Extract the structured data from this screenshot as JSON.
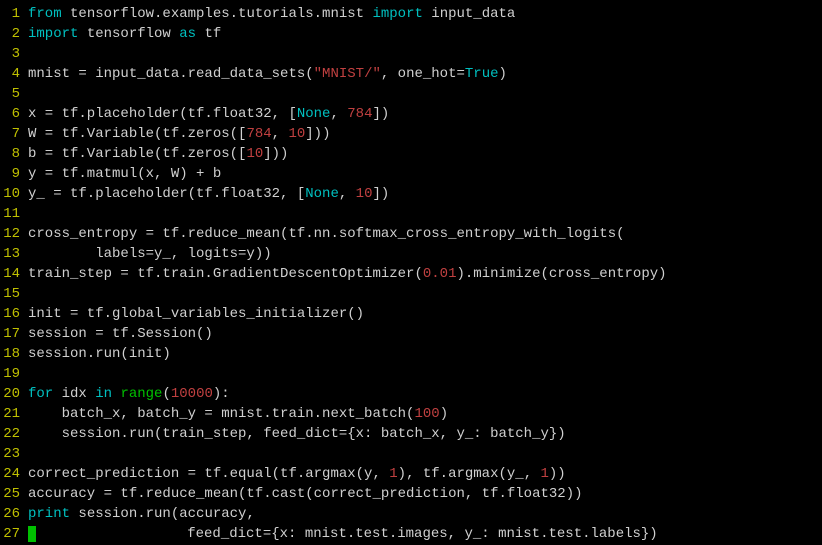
{
  "lines": [
    {
      "n": "1",
      "tokens": [
        [
          "kw",
          "from"
        ],
        [
          "ident",
          " tensorflow.examples.tutorials.mnist "
        ],
        [
          "kw",
          "import"
        ],
        [
          "ident",
          " input_data"
        ]
      ]
    },
    {
      "n": "2",
      "tokens": [
        [
          "kw",
          "import"
        ],
        [
          "ident",
          " tensorflow "
        ],
        [
          "kw",
          "as"
        ],
        [
          "ident",
          " tf"
        ]
      ]
    },
    {
      "n": "3",
      "tokens": []
    },
    {
      "n": "4",
      "tokens": [
        [
          "ident",
          "mnist = input_data.read_data_sets("
        ],
        [
          "str",
          "\"MNIST/\""
        ],
        [
          "ident",
          ", one_hot="
        ],
        [
          "kw",
          "True"
        ],
        [
          "ident",
          ")"
        ]
      ]
    },
    {
      "n": "5",
      "tokens": []
    },
    {
      "n": "6",
      "tokens": [
        [
          "ident",
          "x = tf.placeholder(tf.float32, ["
        ],
        [
          "kw",
          "None"
        ],
        [
          "ident",
          ", "
        ],
        [
          "num",
          "784"
        ],
        [
          "ident",
          "])"
        ]
      ]
    },
    {
      "n": "7",
      "tokens": [
        [
          "ident",
          "W = tf.Variable(tf.zeros(["
        ],
        [
          "num",
          "784"
        ],
        [
          "ident",
          ", "
        ],
        [
          "num",
          "10"
        ],
        [
          "ident",
          "]))"
        ]
      ]
    },
    {
      "n": "8",
      "tokens": [
        [
          "ident",
          "b = tf.Variable(tf.zeros(["
        ],
        [
          "num",
          "10"
        ],
        [
          "ident",
          "]))"
        ]
      ]
    },
    {
      "n": "9",
      "tokens": [
        [
          "ident",
          "y = tf.matmul(x, W) + b"
        ]
      ]
    },
    {
      "n": "10",
      "tokens": [
        [
          "ident",
          "y_ = tf.placeholder(tf.float32, ["
        ],
        [
          "kw",
          "None"
        ],
        [
          "ident",
          ", "
        ],
        [
          "num",
          "10"
        ],
        [
          "ident",
          "])"
        ]
      ]
    },
    {
      "n": "11",
      "tokens": []
    },
    {
      "n": "12",
      "tokens": [
        [
          "ident",
          "cross_entropy = tf.reduce_mean(tf.nn.softmax_cross_entropy_with_logits("
        ]
      ]
    },
    {
      "n": "13",
      "tokens": [
        [
          "ident",
          "        labels=y_, logits=y))"
        ]
      ]
    },
    {
      "n": "14",
      "tokens": [
        [
          "ident",
          "train_step = tf.train.GradientDescentOptimizer("
        ],
        [
          "num",
          "0.01"
        ],
        [
          "ident",
          ").minimize(cross_entropy)"
        ]
      ]
    },
    {
      "n": "15",
      "tokens": []
    },
    {
      "n": "16",
      "tokens": [
        [
          "ident",
          "init = tf.global_variables_initializer()"
        ]
      ]
    },
    {
      "n": "17",
      "tokens": [
        [
          "ident",
          "session = tf.Session()"
        ]
      ]
    },
    {
      "n": "18",
      "tokens": [
        [
          "ident",
          "session.run(init)"
        ]
      ]
    },
    {
      "n": "19",
      "tokens": []
    },
    {
      "n": "20",
      "tokens": [
        [
          "kw",
          "for"
        ],
        [
          "ident",
          " idx "
        ],
        [
          "kw",
          "in"
        ],
        [
          "ident",
          " "
        ],
        [
          "builtin",
          "range"
        ],
        [
          "ident",
          "("
        ],
        [
          "num",
          "10000"
        ],
        [
          "ident",
          "):"
        ]
      ]
    },
    {
      "n": "21",
      "tokens": [
        [
          "ident",
          "    batch_x, batch_y = mnist.train.next_batch("
        ],
        [
          "num",
          "100"
        ],
        [
          "ident",
          ")"
        ]
      ]
    },
    {
      "n": "22",
      "tokens": [
        [
          "ident",
          "    session.run(train_step, feed_dict={x: batch_x, y_: batch_y})"
        ]
      ]
    },
    {
      "n": "23",
      "tokens": []
    },
    {
      "n": "24",
      "tokens": [
        [
          "ident",
          "correct_prediction = tf.equal(tf.argmax(y, "
        ],
        [
          "num",
          "1"
        ],
        [
          "ident",
          "), tf.argmax(y_, "
        ],
        [
          "num",
          "1"
        ],
        [
          "ident",
          "))"
        ]
      ]
    },
    {
      "n": "25",
      "tokens": [
        [
          "ident",
          "accuracy = tf.reduce_mean(tf.cast(correct_prediction, tf.float32))"
        ]
      ]
    },
    {
      "n": "26",
      "tokens": [
        [
          "kw",
          "print"
        ],
        [
          "ident",
          " session.run(accuracy,"
        ]
      ]
    },
    {
      "n": "27",
      "tokens": [
        [
          "ident",
          "                  feed_dict={x: mnist.test.images, y_: mnist.test.labels})"
        ]
      ],
      "cursor_before": true
    }
  ]
}
